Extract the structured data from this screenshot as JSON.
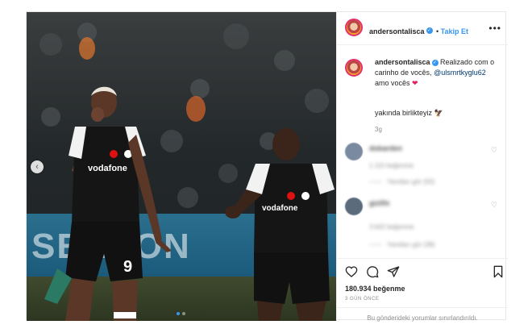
{
  "post": {
    "username": "andersontalisca",
    "follow_label": "Takip Et",
    "caption_text": "Realizado com o carinho de vocês,",
    "caption_mention": "@ulsmrtkyglu62",
    "caption_tail": "amo vocês",
    "second_line": "yakında birlikteyiz",
    "time": "3g",
    "likes": "180.934 beğenme",
    "posted_ago": "3 GÜN ÖNCE",
    "comments_limited": "Bu gönderideki yorumlar sınırlandırıldı.",
    "photo_banner": "SENSON",
    "jersey_sponsor": "vodafone",
    "jersey_number": "9",
    "accent_color": "#3897f0",
    "heart_color": "#e0245e"
  },
  "comments": [
    {
      "name": "dobarden",
      "meta": "1.115 beğenme",
      "replies": "Yanıtları gör (55)"
    },
    {
      "name": "gizlifx",
      "meta": "3.642 beğenme",
      "replies": "Yanıtları gör (38)"
    }
  ],
  "icons": [
    "more-options-icon",
    "verified-badge-icon",
    "heart-icon",
    "comment-icon",
    "share-icon",
    "bookmark-icon",
    "chevron-left-icon"
  ]
}
